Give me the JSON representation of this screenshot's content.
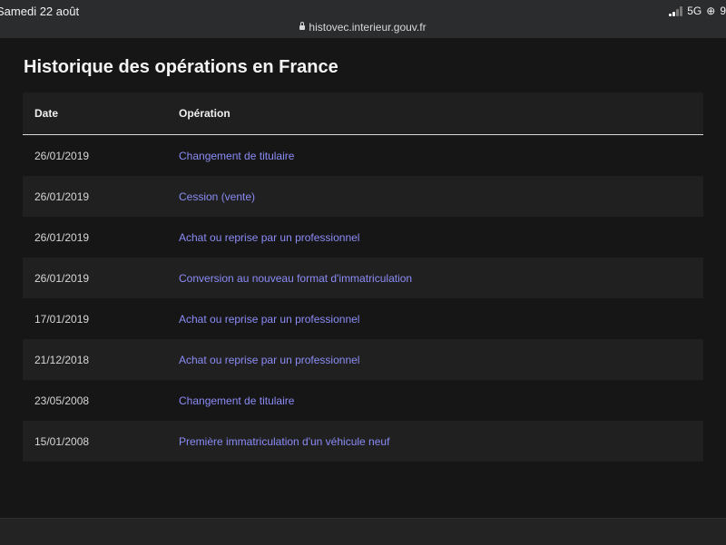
{
  "status": {
    "time": "Samedi 22 août",
    "network": "5G",
    "battery_fragment": "9"
  },
  "browser": {
    "url": "histovec.interieur.gouv.fr"
  },
  "page": {
    "title": "Historique des opérations en France"
  },
  "table": {
    "headers": {
      "date": "Date",
      "operation": "Opération"
    },
    "rows": [
      {
        "date": "26/01/2019",
        "operation": "Changement de titulaire"
      },
      {
        "date": "26/01/2019",
        "operation": "Cession (vente)"
      },
      {
        "date": "26/01/2019",
        "operation": "Achat ou reprise par un professionnel"
      },
      {
        "date": "26/01/2019",
        "operation": "Conversion au nouveau format d'immatriculation"
      },
      {
        "date": "17/01/2019",
        "operation": "Achat ou reprise par un professionnel"
      },
      {
        "date": "21/12/2018",
        "operation": "Achat ou reprise par un professionnel"
      },
      {
        "date": "23/05/2008",
        "operation": "Changement de titulaire"
      },
      {
        "date": "15/01/2008",
        "operation": "Première immatriculation d'un véhicule neuf"
      }
    ]
  },
  "colors": {
    "link": "#8b8cf6",
    "background": "#161616",
    "row_alt": "#202020"
  }
}
